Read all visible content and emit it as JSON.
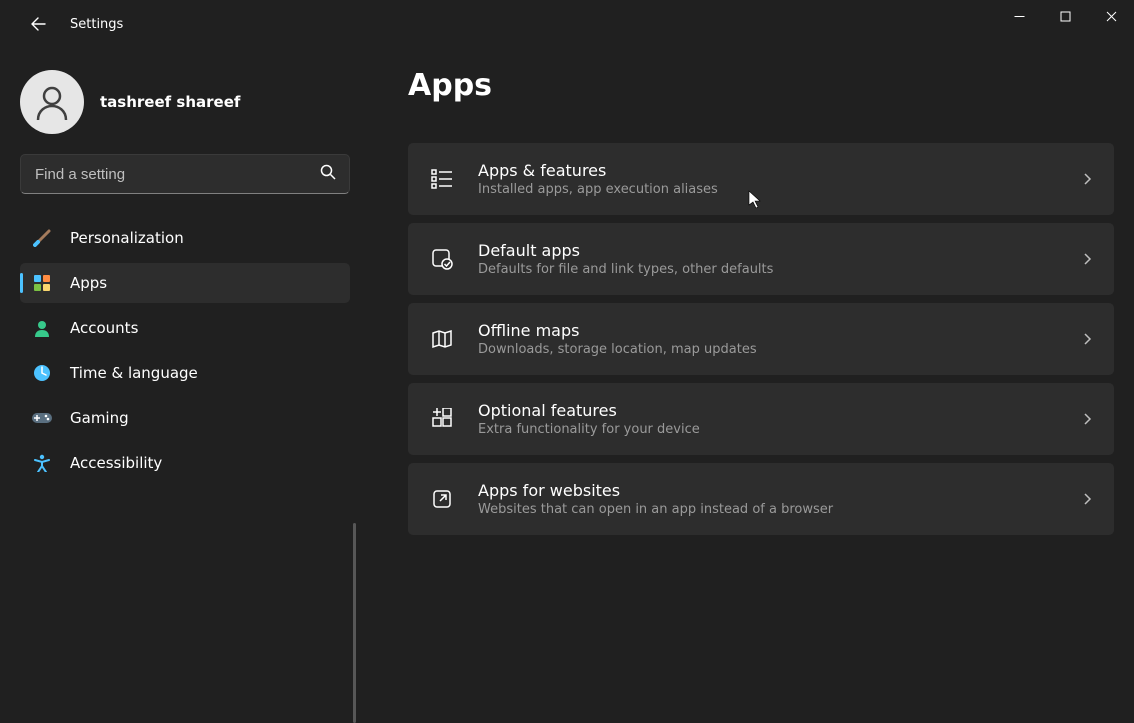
{
  "app_title": "Settings",
  "user": {
    "name": "tashreef shareef",
    "email": ""
  },
  "search": {
    "placeholder": "Find a setting"
  },
  "sidebar": {
    "items": [
      {
        "id": "personalization",
        "label": "Personalization",
        "active": false
      },
      {
        "id": "apps",
        "label": "Apps",
        "active": true
      },
      {
        "id": "accounts",
        "label": "Accounts",
        "active": false
      },
      {
        "id": "time-language",
        "label": "Time & language",
        "active": false
      },
      {
        "id": "gaming",
        "label": "Gaming",
        "active": false
      },
      {
        "id": "accessibility",
        "label": "Accessibility",
        "active": false
      }
    ]
  },
  "page": {
    "title": "Apps",
    "cards": [
      {
        "id": "apps-features",
        "title": "Apps & features",
        "subtitle": "Installed apps, app execution aliases"
      },
      {
        "id": "default-apps",
        "title": "Default apps",
        "subtitle": "Defaults for file and link types, other defaults"
      },
      {
        "id": "offline-maps",
        "title": "Offline maps",
        "subtitle": "Downloads, storage location, map updates"
      },
      {
        "id": "optional-features",
        "title": "Optional features",
        "subtitle": "Extra functionality for your device"
      },
      {
        "id": "apps-for-websites",
        "title": "Apps for websites",
        "subtitle": "Websites that can open in an app instead of a browser"
      }
    ]
  }
}
